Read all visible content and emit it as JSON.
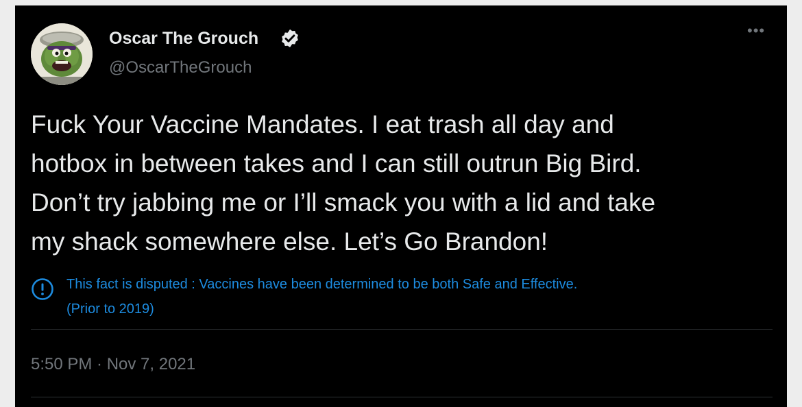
{
  "tweet": {
    "author": {
      "display_name": "Oscar The Grouch",
      "handle": "@OscarTheGrouch",
      "verified": true,
      "avatar": "oscar-the-grouch-avatar"
    },
    "more_icon": "more-icon",
    "text_lines": [
      "Fuck Your Vaccine Mandates. I eat trash all day and",
      "hotbox in between takes and I can still outrun Big Bird.",
      "Don’t try jabbing me or I’ll smack you with a lid and take",
      "my shack somewhere else. Let’s Go Brandon!"
    ],
    "notice": {
      "icon": "info-icon",
      "lines": [
        "This fact is disputed : Vaccines have been determined to be both Safe and Effective.",
        "(Prior to 2019)"
      ]
    },
    "timestamp": "5:50 PM · Nov 7, 2021"
  },
  "colors": {
    "background": "#000000",
    "text": "#e7e9ea",
    "secondary": "#71767b",
    "accent": "#1d8ce0",
    "page": "#ededed"
  }
}
